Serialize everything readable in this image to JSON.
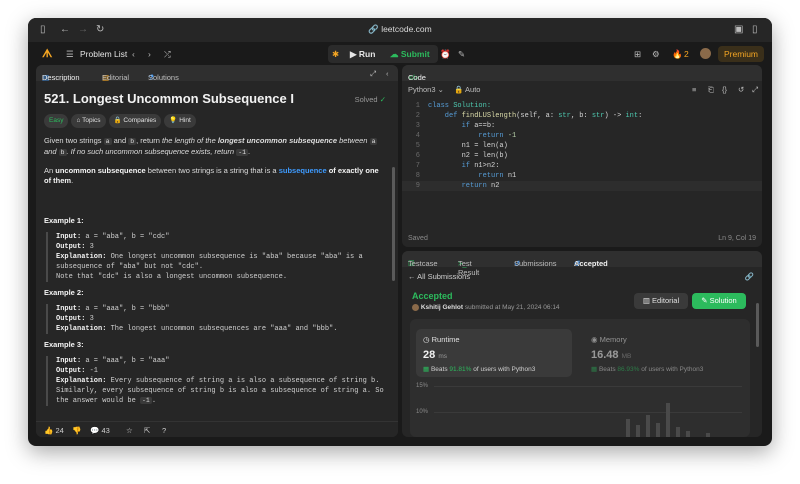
{
  "browser": {
    "url": "leetcode.com"
  },
  "toolbar": {
    "problem_list": "Problem List",
    "run": "Run",
    "submit": "Submit",
    "streak": "2",
    "premium": "Premium"
  },
  "left_tabs": {
    "description": "Description",
    "editorial": "Editorial",
    "solutions": "Solutions"
  },
  "problem": {
    "title": "521. Longest Uncommon Subsequence I",
    "status": "Solved",
    "difficulty": "Easy",
    "topics": "Topics",
    "companies": "Companies",
    "hint": "Hint",
    "p1_a": "Given two strings ",
    "a": "a",
    "p1_b": " and ",
    "b": "b",
    "p1_c": ", return ",
    "p1_d": "the length of the ",
    "p1_e": "longest uncommon subsequence",
    "p1_f": " between ",
    "p1_g": " and ",
    "p1_h": ". If no such uncommon subsequence exists, return ",
    "neg1": "-1",
    "p1_i": ".",
    "p2_a": "An ",
    "p2_b": "uncommon subsequence",
    "p2_c": " between two strings is a string that is a ",
    "p2_d": "subsequence",
    "p2_e": " of exactly one of them",
    "p2_f": ".",
    "examples": [
      {
        "title": "Example 1:",
        "input": "Input: ",
        "input_v": "a = \"aba\", b = \"cdc\"",
        "output": "Output: ",
        "output_v": "3",
        "exp": "Explanation: ",
        "exp_v": "One longest uncommon subsequence is \"aba\" because \"aba\" is a subsequence of \"aba\" but not \"cdc\".",
        "note": "Note that \"cdc\" is also a longest uncommon subsequence."
      },
      {
        "title": "Example 2:",
        "input": "Input: ",
        "input_v": "a = \"aaa\", b = \"bbb\"",
        "output": "Output: ",
        "output_v": "3",
        "exp": "Explanation: ",
        "exp_v": "The longest uncommon subsequences are \"aaa\" and \"bbb\"."
      },
      {
        "title": "Example 3:",
        "input": "Input: ",
        "input_v": "a = \"aaa\", b = \"aaa\"",
        "output": "Output: ",
        "output_v": "-1",
        "exp": "Explanation: ",
        "exp_v": "Every subsequence of string a is also a subsequence of string b. Similarly, every subsequence of string b is also a subsequence of string a. So the answer would be ",
        "exp_v2": "-1",
        "exp_v3": "."
      }
    ],
    "likes": "24",
    "comments": "43"
  },
  "code_panel": {
    "tab": "Code",
    "language": "Python3",
    "mode": "Auto",
    "saved": "Saved",
    "cursor": "Ln 9, Col 19",
    "lines": [
      {
        "n": "1"
      },
      {
        "n": "2"
      },
      {
        "n": "3"
      },
      {
        "n": "4"
      },
      {
        "n": "5"
      },
      {
        "n": "6"
      },
      {
        "n": "7"
      },
      {
        "n": "8"
      },
      {
        "n": "9"
      }
    ],
    "code": {
      "l1a": "class ",
      "l1b": "Solution:",
      "l2a": "    def ",
      "l2b": "findLUSlength",
      "l2c": "(self, a: ",
      "l2d": "str",
      "l2e": ", b: ",
      "l2f": "str",
      "l2g": ") -> ",
      "l2h": "int",
      ":": ":",
      "l3a": "        if ",
      "l3b": "a==b:",
      "l4a": "            return ",
      "l4b": "-1",
      "l5": "        n1 = len(a)",
      "l6": "        n2 = len(b)",
      "l7a": "        if ",
      "l7b": "n1>n2:",
      "l8a": "            return ",
      "l8b": "n1",
      "l9a": "        return ",
      "l9b": "n2"
    }
  },
  "result_panel": {
    "tabs": [
      "Testcase",
      "Test Result",
      "Submissions",
      "Accepted"
    ],
    "back": "All Submissions",
    "status": "Accepted",
    "user": "Kshitij Gehlot",
    "submitted": "submitted at May 21, 2024 06:14",
    "editorial": "Editorial",
    "solution": "Solution",
    "runtime_label": "Runtime",
    "runtime": "28",
    "runtime_unit": "ms",
    "beats_rt_a": "Beats ",
    "beats_rt": "91.81%",
    "beats_rt_b": " of users with Python3",
    "memory_label": "Memory",
    "memory": "16.48",
    "memory_unit": "MB",
    "beats_mem_a": "Beats ",
    "beats_mem": "86.93%",
    "beats_mem_b": " of users with Python3",
    "y15": "15%",
    "y10": "10%"
  }
}
